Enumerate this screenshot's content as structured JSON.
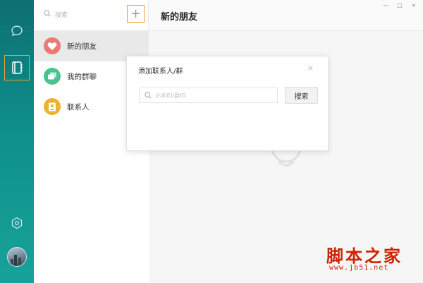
{
  "sidebar": {
    "icons": [
      "chat-bubble-icon",
      "contacts-book-icon",
      "settings-hexagon-icon"
    ],
    "accent": "#f0a030",
    "rail_color": "#0f8f8a"
  },
  "list": {
    "search_placeholder": "搜索",
    "add_label": "+",
    "items": [
      {
        "label": "新的朋友",
        "icon": "heart-icon",
        "color": "#e97b74"
      },
      {
        "label": "我的群聊",
        "icon": "group-chat-icon",
        "color": "#4cc28f"
      },
      {
        "label": "联系人",
        "icon": "contact-card-icon",
        "color": "#f0b030"
      }
    ]
  },
  "main": {
    "title": "新的朋友",
    "window_controls": [
      "—",
      "□",
      "×"
    ]
  },
  "dialog": {
    "title": "添加联系人/群",
    "close": "×",
    "input_placeholder": "小米ID/群ID",
    "search_button": "搜索"
  },
  "watermark": {
    "brand": "脚本之家",
    "url": "www.jb51.net",
    "color": "#cc2200"
  }
}
